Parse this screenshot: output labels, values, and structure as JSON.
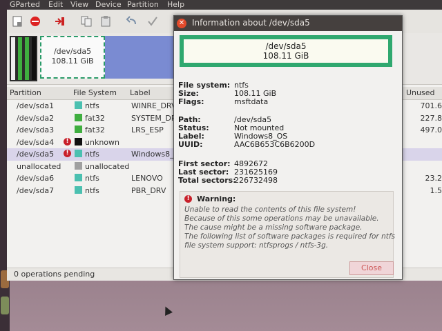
{
  "menubar": {
    "app_name": "GParted",
    "items": [
      "Edit",
      "View",
      "Device",
      "Partition",
      "Help"
    ]
  },
  "toolbar": {
    "icons": [
      "new-icon",
      "delete-icon",
      "resize-move-icon",
      "copy-icon",
      "paste-icon",
      "undo-icon",
      "apply-icon"
    ]
  },
  "partition_map": {
    "selected_name": "/dev/sda5",
    "selected_size": "108.11 GiB"
  },
  "table": {
    "headers": [
      "Partition",
      "File System",
      "Label",
      "Unused"
    ],
    "rows": [
      {
        "partition": "/dev/sda1",
        "fs": "ntfs",
        "fs_color": "#4bc0b0",
        "label": "WINRE_DRV",
        "unused": "701.6",
        "warn": false
      },
      {
        "partition": "/dev/sda2",
        "fs": "fat32",
        "fs_color": "#3fae3f",
        "label": "SYSTEM_DR",
        "unused": "227.8",
        "warn": false
      },
      {
        "partition": "/dev/sda3",
        "fs": "fat32",
        "fs_color": "#3fae3f",
        "label": "LRS_ESP",
        "unused": "497.0",
        "warn": false
      },
      {
        "partition": "/dev/sda4",
        "fs": "unknown",
        "fs_color": "#111111",
        "label": "",
        "unused": "",
        "warn": true
      },
      {
        "partition": "/dev/sda5",
        "fs": "ntfs",
        "fs_color": "#4bc0b0",
        "label": "Windows8_",
        "unused": "",
        "warn": true
      },
      {
        "partition": "unallocated",
        "fs": "unallocated",
        "fs_color": "#a0a0a0",
        "label": "",
        "unused": "",
        "warn": false
      },
      {
        "partition": "/dev/sda6",
        "fs": "ntfs",
        "fs_color": "#4bc0b0",
        "label": "LENOVO",
        "unused": "23.2",
        "warn": false
      },
      {
        "partition": "/dev/sda7",
        "fs": "ntfs",
        "fs_color": "#4bc0b0",
        "label": "PBR_DRV",
        "unused": "1.5",
        "warn": false
      }
    ]
  },
  "status": {
    "text": "0 operations pending"
  },
  "dialog": {
    "title": "Information about /dev/sda5",
    "bar_name": "/dev/sda5",
    "bar_size": "108.11 GiB",
    "fields_1": [
      {
        "k": "File system:",
        "v": "ntfs"
      },
      {
        "k": "Size:",
        "v": "108.11 GiB"
      },
      {
        "k": "Flags:",
        "v": "msftdata"
      }
    ],
    "fields_2": [
      {
        "k": "Path:",
        "v": "/dev/sda5"
      },
      {
        "k": "Status:",
        "v": "Not mounted"
      },
      {
        "k": "Label:",
        "v": "Windows8_OS"
      },
      {
        "k": "UUID:",
        "v": "AAC6B653C6B6200D"
      }
    ],
    "fields_3": [
      {
        "k": "First sector:",
        "v": "4892672"
      },
      {
        "k": "Last sector:",
        "v": "231625169"
      },
      {
        "k": "Total sectors:",
        "v": "226732498"
      }
    ],
    "warning_title": "Warning:",
    "warning_lines": [
      "Unable to read the contents of this file system!",
      "Because of this some operations may be unavailable.",
      "The cause might be a missing software package.",
      "The following list of software packages is required for ntfs",
      "file system support:  ntfsprogs / ntfs-3g."
    ],
    "close_label": "Close"
  },
  "colors": {
    "selected_row": "#d9d4ea",
    "partition_green": "#2fa86f",
    "warning_red": "#c8202a"
  }
}
